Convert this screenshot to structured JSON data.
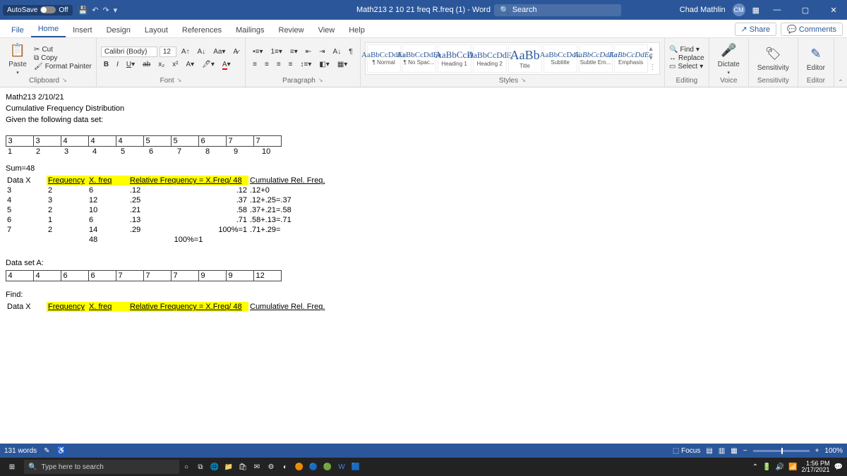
{
  "titlebar": {
    "autosave_label": "AutoSave",
    "autosave_state": "Off",
    "title": "Math213 2 10 21 freq R.freq (1) - Word",
    "search_placeholder": "Search",
    "user_name": "Chad Mathlin",
    "user_initials": "CM"
  },
  "menu": {
    "file": "File",
    "home": "Home",
    "insert": "Insert",
    "design": "Design",
    "layout": "Layout",
    "references": "References",
    "mailings": "Mailings",
    "review": "Review",
    "view": "View",
    "help": "Help",
    "share": "Share",
    "comments": "Comments"
  },
  "ribbon": {
    "clipboard": {
      "label": "Clipboard",
      "paste": "Paste",
      "cut": "Cut",
      "copy": "Copy",
      "fmtpainter": "Format Painter"
    },
    "font": {
      "label": "Font",
      "name": "Calibri (Body)",
      "size": "12"
    },
    "paragraph": {
      "label": "Paragraph"
    },
    "styles": {
      "label": "Styles",
      "items": [
        {
          "preview": "AaBbCcDdEe",
          "name": "¶ Normal"
        },
        {
          "preview": "AaBbCcDdEe",
          "name": "¶ No Spac..."
        },
        {
          "preview": "AaBbCcD",
          "name": "Heading 1"
        },
        {
          "preview": "AaBbCcDdE",
          "name": "Heading 2"
        },
        {
          "preview": "AaBb",
          "name": "Title"
        },
        {
          "preview": "AaBbCcDdE",
          "name": "Subtitle"
        },
        {
          "preview": "AaBbCcDdEe",
          "name": "Subtle Em..."
        },
        {
          "preview": "AaBbCcDdEe",
          "name": "Emphasis"
        }
      ]
    },
    "editing": {
      "label": "Editing",
      "find": "Find",
      "replace": "Replace",
      "select": "Select"
    },
    "voice": {
      "label": "Voice",
      "dictate": "Dictate"
    },
    "sensitivity": {
      "label": "Sensitivity",
      "btn": "Sensitivity"
    },
    "editor": {
      "label": "Editor",
      "btn": "Editor"
    }
  },
  "doc": {
    "line1": "Math213  2/10/21",
    "line2": "Cumulative Frequency Distribution",
    "line3": "Given the following data set:",
    "table1_top": [
      "3",
      "3",
      "4",
      "4",
      "4",
      "5",
      "5",
      "6",
      "7",
      "7"
    ],
    "table1_bot": [
      "1",
      "2",
      "3",
      "4",
      "5",
      "6",
      "7",
      "8",
      "9",
      "10"
    ],
    "sum": "Sum=48",
    "hdr": {
      "x": "Data X",
      "freq": "Frequency",
      "xfreq": "X. freq",
      "rel": "Relative Frequency = X.Freq/ 48",
      "cum": "Cumulative Rel. Freq."
    },
    "rows": [
      {
        "x": "3",
        "f": "2",
        "xf": "6",
        "rf": ".12",
        "rfv": ".12",
        "c": ".12+0"
      },
      {
        "x": "4",
        "f": "3",
        "xf": "12",
        "rf": ".25",
        "rfv": ".37",
        "c": ".12+.25=.37"
      },
      {
        "x": "5",
        "f": "2",
        "xf": "10",
        "rf": ".21",
        "rfv": ".58",
        "c": ".37+.21=.58"
      },
      {
        "x": "6",
        "f": "1",
        "xf": "6",
        "rf": ".13",
        "rfv": ".71",
        "c": ".58+.13=.71"
      },
      {
        "x": "7",
        "f": "2",
        "xf": "14",
        "rf": ".29",
        "rfv": "100%=1",
        "c": ".71+.29="
      }
    ],
    "totals": {
      "xf": "48",
      "rf": "100%=1"
    },
    "setA_label": "Data set A:",
    "setA": [
      "4",
      "4",
      "6",
      "6",
      "7",
      "7",
      "7",
      "9",
      "9",
      "12"
    ],
    "find": "Find:"
  },
  "statusbar": {
    "words": "131 words",
    "focus": "Focus",
    "zoom": "100%"
  },
  "taskbar": {
    "search": "Type here to search",
    "time": "1:56 PM",
    "date": "2/17/2021"
  }
}
